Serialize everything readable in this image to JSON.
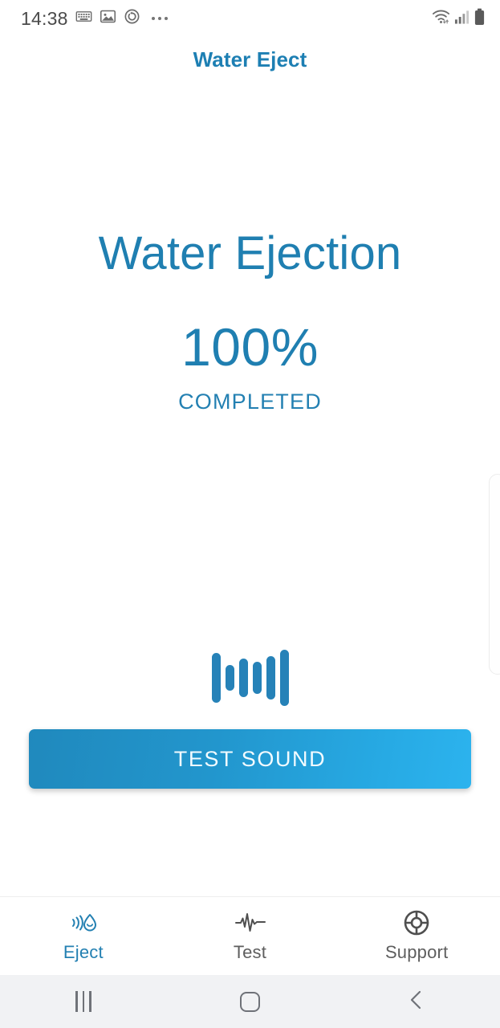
{
  "status_bar": {
    "clock": "14:38",
    "left_icons": [
      "keyboard-icon",
      "image-icon",
      "sync-circle-icon",
      "more-ellipsis-icon"
    ],
    "right_icons": [
      "wifi-icon",
      "cellular-signal-icon",
      "battery-icon"
    ]
  },
  "app": {
    "title": "Water Eject",
    "accent_color": "#1d7fb3"
  },
  "main": {
    "headline": "Water Ejection",
    "percent": "100%",
    "status_label": "COMPLETED",
    "progress_value": 100,
    "waveform_icon": "sound-waveform-icon",
    "waveform_bars": [
      62,
      32,
      48,
      40,
      54,
      70
    ],
    "test_sound_button": {
      "label": "TEST SOUND",
      "gradient_start": "#2089bd",
      "gradient_end": "#2cb3ee"
    }
  },
  "edge_panel": {
    "handle": "edge-panel-handle"
  },
  "tab_bar": {
    "active_color": "#2380b2",
    "inactive_color": "#5e5e5e",
    "tabs": [
      {
        "label": "Eject",
        "icon": "water-eject-icon",
        "active": true
      },
      {
        "label": "Test",
        "icon": "pulse-waveform-icon",
        "active": false
      },
      {
        "label": "Support",
        "icon": "lifebuoy-icon",
        "active": false
      }
    ]
  },
  "nav_bar": {
    "buttons": [
      {
        "name": "recents-button",
        "icon": "recents-icon"
      },
      {
        "name": "home-button",
        "icon": "home-icon"
      },
      {
        "name": "back-button",
        "icon": "back-chevron-icon"
      }
    ]
  }
}
